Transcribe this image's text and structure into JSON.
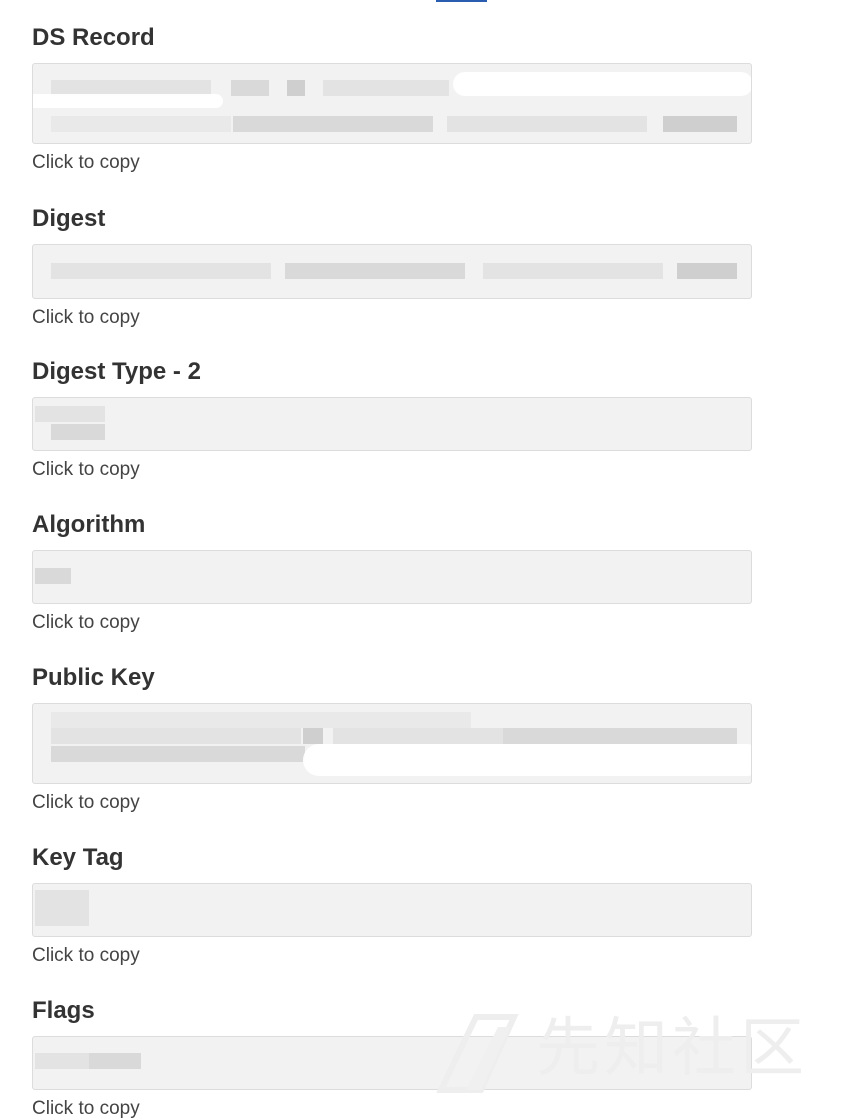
{
  "fields": [
    {
      "label": "DS Record",
      "value": "",
      "copy_hint": "Click to copy"
    },
    {
      "label": "Digest",
      "value": "",
      "copy_hint": "Click to copy"
    },
    {
      "label": "Digest Type - 2",
      "value": "",
      "copy_hint": "Click to copy"
    },
    {
      "label": "Algorithm",
      "value": "",
      "copy_hint": "Click to copy"
    },
    {
      "label": "Public Key",
      "value": "",
      "copy_hint": "Click to copy"
    },
    {
      "label": "Key Tag",
      "value": "",
      "copy_hint": "Click to copy"
    },
    {
      "label": "Flags",
      "value": "",
      "copy_hint": "Click to copy"
    }
  ],
  "watermark": {
    "text": "先知社区"
  },
  "colors": {
    "accent": "#2a5db0",
    "box_bg": "#f2f2f2",
    "box_border": "#dcdcdc",
    "text": "#333333"
  }
}
